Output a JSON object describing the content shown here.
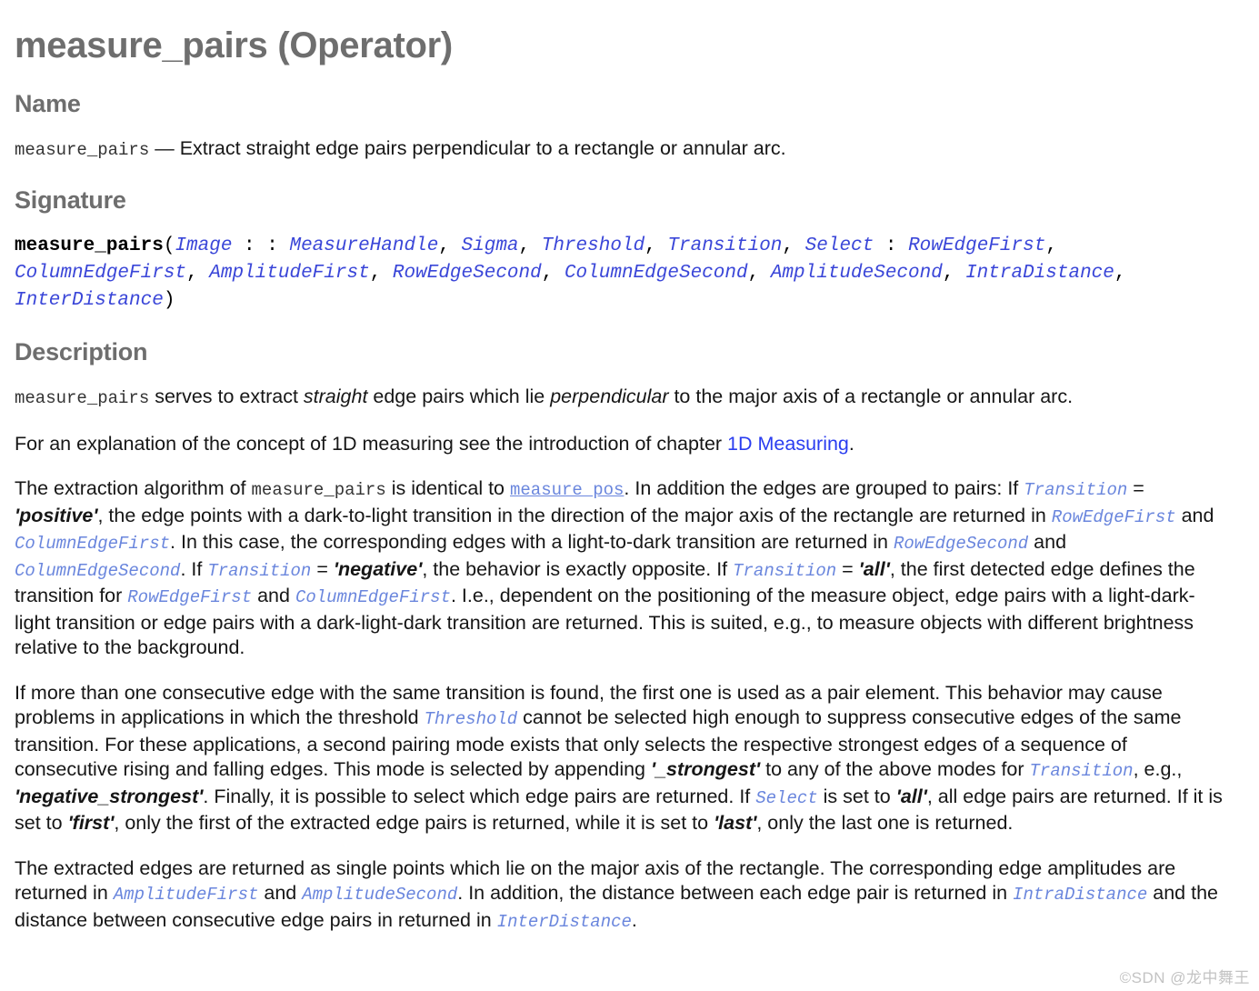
{
  "document": {
    "title": "measure_pairs (Operator)",
    "operator_name": "measure_pairs"
  },
  "sections": {
    "name": {
      "heading": "Name",
      "operator": "measure_pairs",
      "dash": "—",
      "summary": "Extract straight edge pairs perpendicular to a rectangle or annular arc."
    },
    "signature": {
      "heading": "Signature",
      "operator": "measure_pairs",
      "open_paren": "(",
      "close_paren": ")",
      "colons": " : : ",
      "comma": ", ",
      "input_params": [
        "Image"
      ],
      "control_params": [
        "MeasureHandle",
        "Sigma",
        "Threshold",
        "Transition",
        "Select"
      ],
      "output_params": [
        "RowEdgeFirst",
        "ColumnEdgeFirst",
        "AmplitudeFirst",
        "RowEdgeSecond",
        "ColumnEdgeSecond",
        "AmplitudeSecond",
        "IntraDistance",
        "InterDistance"
      ],
      "full_text": "measure_pairs(Image : : MeasureHandle, Sigma, Threshold, Transition, Select : RowEdgeFirst, ColumnEdgeFirst, AmplitudeFirst, RowEdgeSecond, ColumnEdgeSecond, AmplitudeSecond, IntraDistance, InterDistance)"
    },
    "description": {
      "heading": "Description",
      "paragraph1": {
        "code_measure_pairs": "measure_pairs",
        "t1": " serves to extract ",
        "em1": "straight",
        "t2": " edge pairs which lie ",
        "em2": "perpendicular",
        "t3": " to the major axis of a rectangle or annular arc."
      },
      "paragraph2": {
        "t1": "For an explanation of the concept of 1D measuring see the introduction of chapter ",
        "link": "1D Measuring",
        "t2": "."
      },
      "paragraph3": {
        "t1": "The extraction algorithm of ",
        "code1": "measure_pairs",
        "t2": " is identical to ",
        "link1": "measure_pos",
        "t3": ". In addition the edges are grouped to pairs: If ",
        "p1": "Transition",
        "t4": " = ",
        "v1": "'positive'",
        "t5": ", the edge points with a dark-to-light transition in the direction of the major axis of the rectangle are returned in ",
        "p2": "RowEdgeFirst",
        "t6": " and ",
        "p3": "ColumnEdgeFirst",
        "t7": ". In this case, the corresponding edges with a light-to-dark transition are returned in ",
        "p4": "RowEdgeSecond",
        "t8": " and ",
        "p5": "ColumnEdgeSecond",
        "t9": ". If ",
        "p6": "Transition",
        "t10": " = ",
        "v2": "'negative'",
        "t11": ", the behavior is exactly opposite. If ",
        "p7": "Transition",
        "t12": " = ",
        "v3": "'all'",
        "t13": ", the first detected edge defines the transition for ",
        "p8": "RowEdgeFirst",
        "t14": " and ",
        "p9": "ColumnEdgeFirst",
        "t15": ". I.e., dependent on the positioning of the measure object, edge pairs with a light-dark-light transition or edge pairs with a dark-light-dark transition are returned. This is suited, e.g., to measure objects with different brightness relative to the background."
      },
      "paragraph4": {
        "t1": "If more than one consecutive edge with the same transition is found, the first one is used as a pair element. This behavior may cause problems in applications in which the threshold ",
        "p1": "Threshold",
        "t2": " cannot be selected high enough to suppress consecutive edges of the same transition. For these applications, a second pairing mode exists that only selects the respective strongest edges of a sequence of consecutive rising and falling edges. This mode is selected by appending ",
        "v1": "'_strongest'",
        "t3": " to any of the above modes for ",
        "p2": "Transition",
        "t4": ", e.g., ",
        "v2": "'negative_strongest'",
        "t5": ". Finally, it is possible to select which edge pairs are returned. If ",
        "p3": "Select",
        "t6": " is set to ",
        "v3": "'all'",
        "t7": ", all edge pairs are returned. If it is set to ",
        "v4": "'first'",
        "t8": ", only the first of the extracted edge pairs is returned, while it is set to ",
        "v5": "'last'",
        "t9": ", only the last one is returned."
      },
      "paragraph5": {
        "t1": "The extracted edges are returned as single points which lie on the major axis of the rectangle. The corresponding edge amplitudes are returned in ",
        "p1": "AmplitudeFirst",
        "t2": " and ",
        "p2": "AmplitudeSecond",
        "t3": ". In addition, the distance between each edge pair is returned in ",
        "p3": "IntraDistance",
        "t4": " and the distance between consecutive edge pairs in returned in ",
        "p4": "InterDistance",
        "t5": "."
      }
    }
  },
  "watermark": {
    "text": "©SDN @龙中舞王"
  },
  "colors": {
    "heading": "#6e6e6e",
    "body_text": "#161616",
    "signature_param": "#3a46d8",
    "inline_param": "#6a86dd",
    "hyperlink": "#2a3df0",
    "watermark": "#c3c3c3",
    "background": "#ffffff"
  }
}
